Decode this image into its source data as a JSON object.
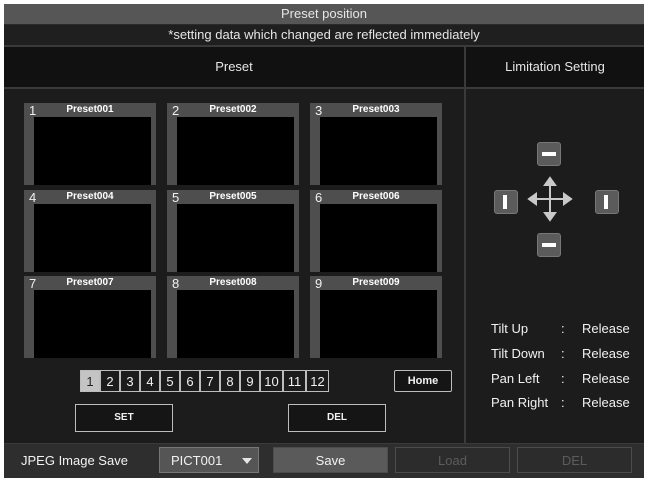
{
  "window": {
    "title": "Preset position",
    "notice": "*setting data which changed are reflected immediately"
  },
  "headers": {
    "preset": "Preset",
    "limitation": "Limitation Setting"
  },
  "presets": [
    {
      "number": "1",
      "name": "Preset001"
    },
    {
      "number": "2",
      "name": "Preset002"
    },
    {
      "number": "3",
      "name": "Preset003"
    },
    {
      "number": "4",
      "name": "Preset004"
    },
    {
      "number": "5",
      "name": "Preset005"
    },
    {
      "number": "6",
      "name": "Preset006"
    },
    {
      "number": "7",
      "name": "Preset007"
    },
    {
      "number": "8",
      "name": "Preset008"
    },
    {
      "number": "9",
      "name": "Preset009"
    }
  ],
  "pages": [
    "1",
    "2",
    "3",
    "4",
    "5",
    "6",
    "7",
    "8",
    "9",
    "10",
    "11",
    "12"
  ],
  "active_page": "1",
  "buttons": {
    "home": "Home",
    "set": "SET",
    "del": "DEL"
  },
  "limits": [
    {
      "label": "Tilt Up",
      "sep": ":",
      "value": "Release"
    },
    {
      "label": "Tilt Down",
      "sep": ":",
      "value": "Release"
    },
    {
      "label": "Pan Left",
      "sep": ":",
      "value": "Release"
    },
    {
      "label": "Pan Right",
      "sep": ":",
      "value": "Release"
    }
  ],
  "jpeg": {
    "label": "JPEG Image Save",
    "selected": "PICT001",
    "save": "Save",
    "load": "Load",
    "del": "DEL"
  },
  "icons": {
    "dropdown": "dropdown-arrow-icon",
    "move": "move-arrows-icon"
  }
}
